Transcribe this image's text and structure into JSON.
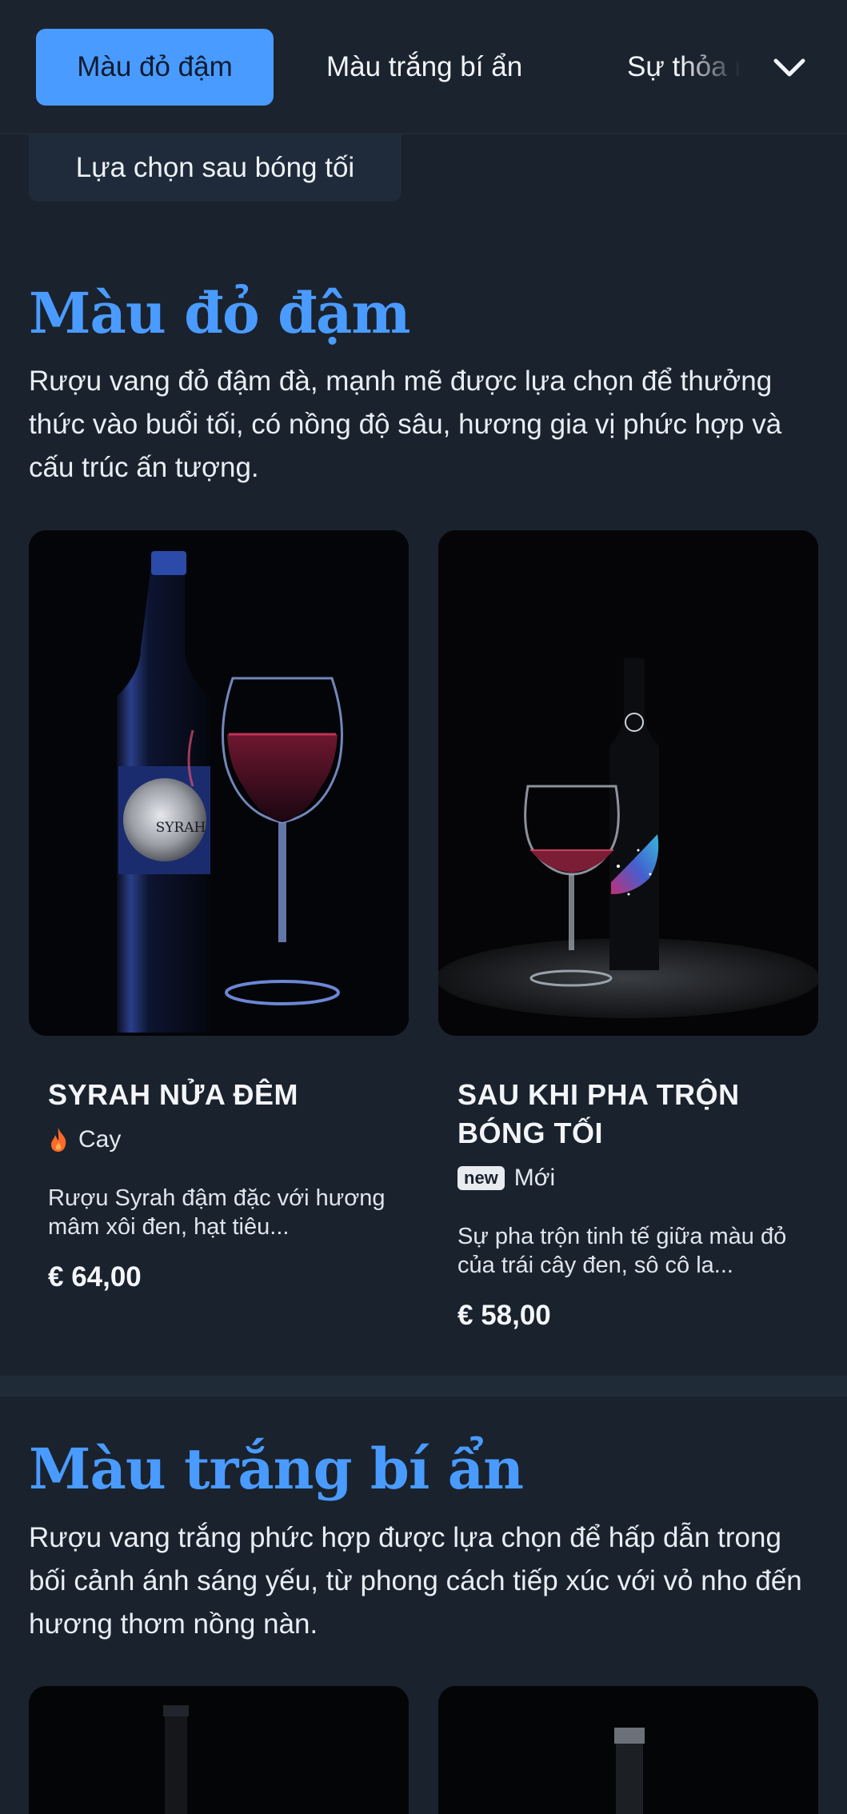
{
  "nav": {
    "tabs": [
      {
        "label": "Màu đỏ đậm",
        "active": true
      },
      {
        "label": "Màu trắng bí ẩn",
        "active": false
      },
      {
        "label": "Sự thỏa mãn",
        "active": false
      }
    ],
    "expand_icon": "chevron-down-icon",
    "sub_tab": "Lựa chọn sau bóng tối"
  },
  "sections": [
    {
      "title": "Màu đỏ đậm",
      "description": "Rượu vang đỏ đậm đà, mạnh mẽ được lựa chọn để thưởng thức vào buổi tối, có nồng độ sâu, hương gia vị phức hợp và cấu trúc ấn tượng.",
      "products": [
        {
          "name": "SYRAH NỬA ĐÊM",
          "tag": "Cay",
          "tag_icon": "flame-icon",
          "description": "Rượu Syrah đậm đặc với hương mâm xôi đen, hạt tiêu...",
          "price": "€ 64,00",
          "label_text": "SYRAH"
        },
        {
          "name": "SAU KHI PHA TRỘN BÓNG TỐI",
          "tag": "Mới",
          "tag_badge": "new",
          "description": "Sự pha trộn tinh tế giữa màu đỏ của trái cây đen, sô cô la...",
          "price": "€ 58,00"
        }
      ]
    },
    {
      "title": "Màu trắng bí ẩn",
      "description": "Rượu vang trắng phức hợp được lựa chọn để hấp dẫn trong bối cảnh ánh sáng yếu, từ phong cách tiếp xúc với vỏ nho đến hương thơm nồng nàn."
    }
  ],
  "colors": {
    "accent": "#4a9bff",
    "background": "#1a222d",
    "flame": "#ff6a2b"
  }
}
